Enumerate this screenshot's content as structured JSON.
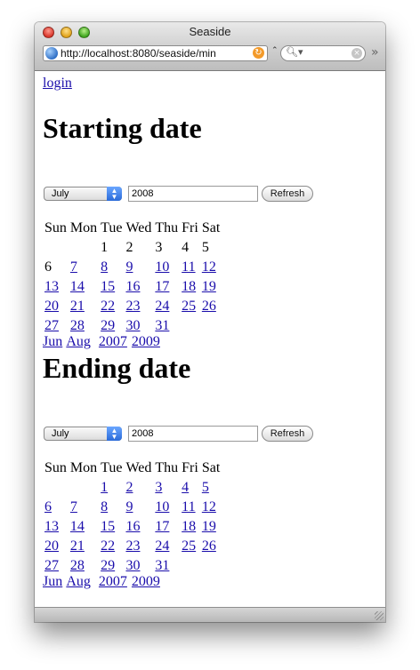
{
  "window": {
    "title": "Seaside"
  },
  "toolbar": {
    "url": "http://localhost:8080/seaside/min",
    "search_placeholder": "",
    "overflow_label": "»"
  },
  "page": {
    "login_link": "login"
  },
  "calendars": [
    {
      "heading": "Starting date",
      "month_selected": "July",
      "year_value": "2008",
      "refresh_label": "Refresh",
      "weekdays": [
        "Sun",
        "Mon",
        "Tue",
        "Wed",
        "Thu",
        "Fri",
        "Sat"
      ],
      "weeks": [
        [
          {
            "d": ""
          },
          {
            "d": ""
          },
          {
            "d": "1",
            "link": false
          },
          {
            "d": "2",
            "link": false
          },
          {
            "d": "3",
            "link": false
          },
          {
            "d": "4",
            "link": false
          },
          {
            "d": "5",
            "link": false
          }
        ],
        [
          {
            "d": "6",
            "link": false
          },
          {
            "d": "7",
            "link": true
          },
          {
            "d": "8",
            "link": true
          },
          {
            "d": "9",
            "link": true
          },
          {
            "d": "10",
            "link": true
          },
          {
            "d": "11",
            "link": true
          },
          {
            "d": "12",
            "link": true
          }
        ],
        [
          {
            "d": "13",
            "link": true
          },
          {
            "d": "14",
            "link": true
          },
          {
            "d": "15",
            "link": true
          },
          {
            "d": "16",
            "link": true
          },
          {
            "d": "17",
            "link": true
          },
          {
            "d": "18",
            "link": true
          },
          {
            "d": "19",
            "link": true
          }
        ],
        [
          {
            "d": "20",
            "link": true
          },
          {
            "d": "21",
            "link": true
          },
          {
            "d": "22",
            "link": true
          },
          {
            "d": "23",
            "link": true
          },
          {
            "d": "24",
            "link": true
          },
          {
            "d": "25",
            "link": true
          },
          {
            "d": "26",
            "link": true
          }
        ],
        [
          {
            "d": "27",
            "link": true
          },
          {
            "d": "28",
            "link": true
          },
          {
            "d": "29",
            "link": true
          },
          {
            "d": "30",
            "link": true
          },
          {
            "d": "31",
            "link": true
          },
          {
            "d": ""
          },
          {
            "d": ""
          }
        ]
      ],
      "nav": {
        "prev_month": "Jun",
        "next_month": "Aug",
        "prev_year": "2007",
        "next_year": "2009"
      }
    },
    {
      "heading": "Ending date",
      "month_selected": "July",
      "year_value": "2008",
      "refresh_label": "Refresh",
      "weekdays": [
        "Sun",
        "Mon",
        "Tue",
        "Wed",
        "Thu",
        "Fri",
        "Sat"
      ],
      "weeks": [
        [
          {
            "d": ""
          },
          {
            "d": ""
          },
          {
            "d": "1",
            "link": true
          },
          {
            "d": "2",
            "link": true
          },
          {
            "d": "3",
            "link": true
          },
          {
            "d": "4",
            "link": true
          },
          {
            "d": "5",
            "link": true
          }
        ],
        [
          {
            "d": "6",
            "link": true
          },
          {
            "d": "7",
            "link": true
          },
          {
            "d": "8",
            "link": true
          },
          {
            "d": "9",
            "link": true
          },
          {
            "d": "10",
            "link": true
          },
          {
            "d": "11",
            "link": true
          },
          {
            "d": "12",
            "link": true
          }
        ],
        [
          {
            "d": "13",
            "link": true
          },
          {
            "d": "14",
            "link": true
          },
          {
            "d": "15",
            "link": true
          },
          {
            "d": "16",
            "link": true
          },
          {
            "d": "17",
            "link": true
          },
          {
            "d": "18",
            "link": true
          },
          {
            "d": "19",
            "link": true
          }
        ],
        [
          {
            "d": "20",
            "link": true
          },
          {
            "d": "21",
            "link": true
          },
          {
            "d": "22",
            "link": true
          },
          {
            "d": "23",
            "link": true
          },
          {
            "d": "24",
            "link": true
          },
          {
            "d": "25",
            "link": true
          },
          {
            "d": "26",
            "link": true
          }
        ],
        [
          {
            "d": "27",
            "link": true
          },
          {
            "d": "28",
            "link": true
          },
          {
            "d": "29",
            "link": true
          },
          {
            "d": "30",
            "link": true
          },
          {
            "d": "31",
            "link": true
          },
          {
            "d": ""
          },
          {
            "d": ""
          }
        ]
      ],
      "nav": {
        "prev_month": "Jun",
        "next_month": "Aug",
        "prev_year": "2007",
        "next_year": "2009"
      }
    }
  ],
  "colors": {
    "link": "#1a0dab",
    "select_accent": "#2a6ad8"
  }
}
